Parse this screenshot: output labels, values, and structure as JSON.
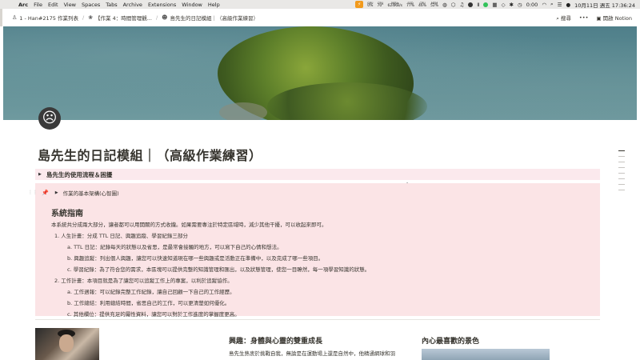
{
  "menubar": {
    "app": "Arc",
    "items": [
      "File",
      "Edit",
      "View",
      "Spaces",
      "Tabs",
      "Archive",
      "Extensions",
      "Window",
      "Help"
    ],
    "stats": [
      {
        "label": "GPU",
        "value": "0%"
      },
      {
        "label": "CPU",
        "value": "70°"
      },
      {
        "label": "0KB/s",
        "value": "624KB/s"
      },
      {
        "label": "SSD",
        "value": "77%"
      },
      {
        "label": "CPU",
        "value": "46%"
      },
      {
        "label": "MEM",
        "value": "52%"
      }
    ],
    "time_counter": "0:00",
    "datetime": "10月11日 週五  17:36:24"
  },
  "topbar": {
    "breadcrumbs": [
      {
        "icon": "workspace-icon",
        "label": "1 - Han#2175 作業列表"
      },
      {
        "icon": "page-icon",
        "label": "【作業 4：時間管理觀..."
      },
      {
        "icon": "avatar-icon",
        "label": "島先生的日記模組｜（高級作業練習）"
      }
    ],
    "search_label": "搜尋",
    "more_label": "•••",
    "open_in_notion": "開啟 Notion"
  },
  "page": {
    "title": "島先生的日記模組｜（高級作業練習）",
    "toggle_heading": "島先生的使用流程＆困擾",
    "callout": {
      "toggle_label": "作業的基本架構(心智圖)",
      "section_title": "系統指南",
      "description": "本系統共分成兩大部分，讓者都可以用開關的方式收攏。如果需要專注於特定區域時，減少其他干擾，可以收起來即可。",
      "list": [
        {
          "label": "1.  人生計畫：分成 TTL 日記、興趣追蹤、學習紀錄三部分",
          "sub": [
            "a.  TTL 日記：紀錄每天的狀態以及省思，是最常會接觸的地方，可以寫下自己的心情和想法。",
            "b.  興趣追蹤：列出個人興趣，讓您可以快速知道現在哪一些興趣或是活動正在準備中，以及完成了哪一些項目。",
            "c.  學習紀錄：為了符合您的需求，本區塊可以提供完整的知識管理和匯出，以及狀態管理，使您一目瞭然，每一項學習知識的狀態。"
          ]
        },
        {
          "label": "2.  工作計畫：本項目就是為了讓您可以追蹤工作上的專案，以利於追蹤協作。",
          "sub": [
            "a.  工作週報：可以紀錄完整工作紀錄，讓自己回顧一下自己的工作經歷。",
            "b.  工作總結：利用總結時間，省思自己的工作，可以更清楚如何優化。",
            "c.  其他欄位：提供充足的屬性資料，讓您可以對於工作進度的掌握度更高。"
          ]
        }
      ]
    },
    "interest_heading": "興趣：身體與心靈的雙重成長",
    "interest_text": "島先生熱衷於挑戰自我，無論是在運動場上還是自然中，他精通網球和羽",
    "scene_heading": "內心最喜歡的景色"
  }
}
